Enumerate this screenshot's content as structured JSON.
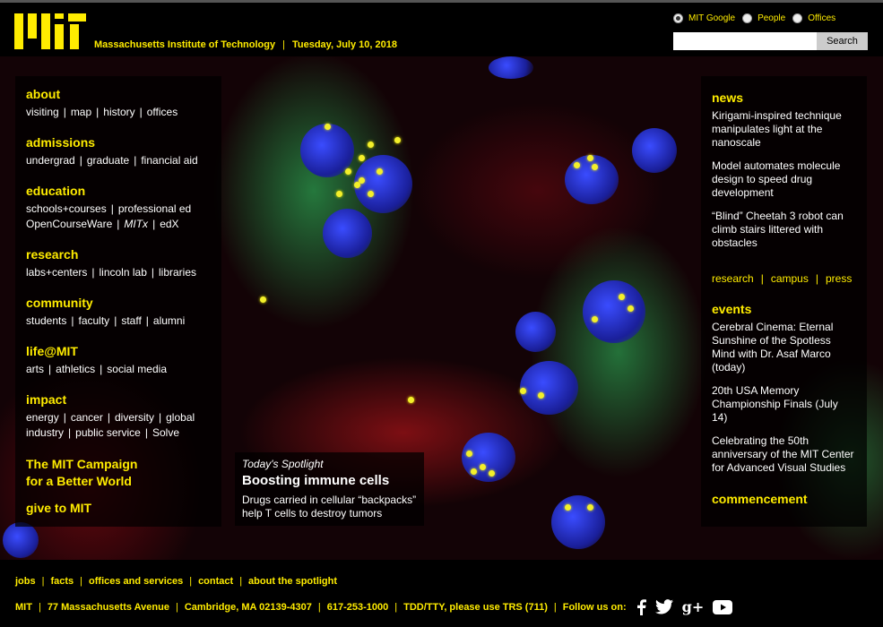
{
  "header": {
    "logo_text": "MIT",
    "institute": "Massachusetts Institute of Technology",
    "date": "Tuesday, July 10, 2018",
    "search": {
      "options": [
        "MIT Google",
        "People",
        "Offices"
      ],
      "selected": "MIT Google",
      "placeholder": "",
      "button_label": "Search"
    }
  },
  "left_nav": [
    {
      "title": "about",
      "links": [
        [
          "visiting",
          "map",
          "history",
          "offices"
        ]
      ]
    },
    {
      "title": "admissions",
      "links": [
        [
          "undergrad",
          "graduate",
          "financial aid"
        ]
      ]
    },
    {
      "title": "education",
      "links": [
        [
          "schools+courses",
          "professional ed"
        ],
        [
          "OpenCourseWare",
          "MITx",
          "edX"
        ]
      ]
    },
    {
      "title": "research",
      "links": [
        [
          "labs+centers",
          "lincoln lab",
          "libraries"
        ]
      ]
    },
    {
      "title": "community",
      "links": [
        [
          "students",
          "faculty",
          "staff",
          "alumni"
        ]
      ]
    },
    {
      "title": "life@MIT",
      "links": [
        [
          "arts",
          "athletics",
          "social media"
        ]
      ]
    },
    {
      "title": "impact",
      "links": [
        [
          "energy",
          "cancer",
          "diversity",
          "global"
        ],
        [
          "industry",
          "public service",
          "Solve"
        ]
      ]
    }
  ],
  "campaign": {
    "line1": "The MIT Campaign",
    "line2": "for a Better World"
  },
  "give": "give to MIT",
  "spotlight": {
    "label": "Today's Spotlight",
    "title": "Boosting immune cells",
    "description": "Drugs carried in cellular “backpacks” help T cells to destroy tumors"
  },
  "news": {
    "title": "news",
    "items": [
      "Kirigami-inspired technique manipulates light at the nanoscale",
      "Model automates molecule design to speed drug development",
      "“Blind” Cheetah 3 robot can climb stairs littered with obstacles"
    ],
    "links": [
      "research",
      "campus",
      "press"
    ]
  },
  "events": {
    "title": "events",
    "items": [
      "Cerebral Cinema: Eternal Sunshine of the Spotless Mind with Dr. Asaf Marco (today)",
      "20th USA Memory Championship Finals (July 14)",
      "Celebrating the 50th anniversary of the MIT Center for Advanced Visual Studies"
    ]
  },
  "commencement": "commencement",
  "footer": {
    "links": [
      "jobs",
      "facts",
      "offices and services",
      "contact",
      "about the spotlight"
    ],
    "info": [
      "MIT",
      "77 Massachusetts Avenue",
      "Cambridge, MA 02139-4307",
      "617-253-1000",
      "TDD/TTY, please use TRS (711)"
    ],
    "follow_label": "Follow us on:",
    "social": [
      "facebook-icon",
      "twitter-icon",
      "google-plus-icon",
      "youtube-icon"
    ]
  },
  "colors": {
    "accent": "#ffec00",
    "background": "#000000"
  }
}
